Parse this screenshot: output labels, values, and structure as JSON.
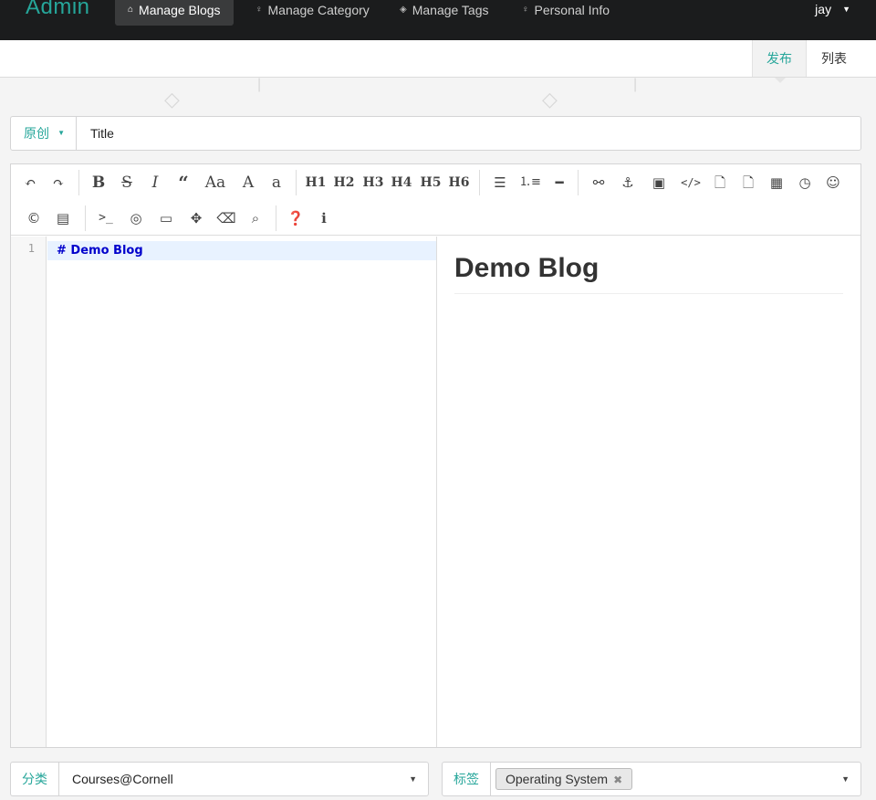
{
  "nav": {
    "brand": "Admin",
    "items": [
      {
        "label": "Manage Blogs",
        "icon": "home-icon",
        "active": true
      },
      {
        "label": "Manage Category",
        "icon": "idea-icon",
        "active": false
      },
      {
        "label": "Manage Tags",
        "icon": "tags-icon",
        "active": false
      },
      {
        "label": "Personal Info",
        "icon": "idea-icon",
        "active": false
      }
    ],
    "user": "jay"
  },
  "subtabs": {
    "publish": "发布",
    "list": "列表"
  },
  "title_row": {
    "type_select": "原创",
    "title_value": "Title"
  },
  "editor": {
    "toolbar_text": {
      "h1": "H1",
      "h2": "H2",
      "h3": "H3",
      "h4": "H4",
      "h5": "H5",
      "h6": "H6",
      "case": "Aa",
      "upper": "A",
      "lower": "a"
    },
    "line_number": "1",
    "code_line": "# Demo Blog",
    "preview_heading": "Demo Blog"
  },
  "bottom": {
    "category_label": "分类",
    "category_value": "Courses@Cornell",
    "tags_label": "标签",
    "tags": [
      "Operating System"
    ]
  },
  "colors": {
    "accent": "#26a69a",
    "nav_bg": "#1b1c1d"
  }
}
